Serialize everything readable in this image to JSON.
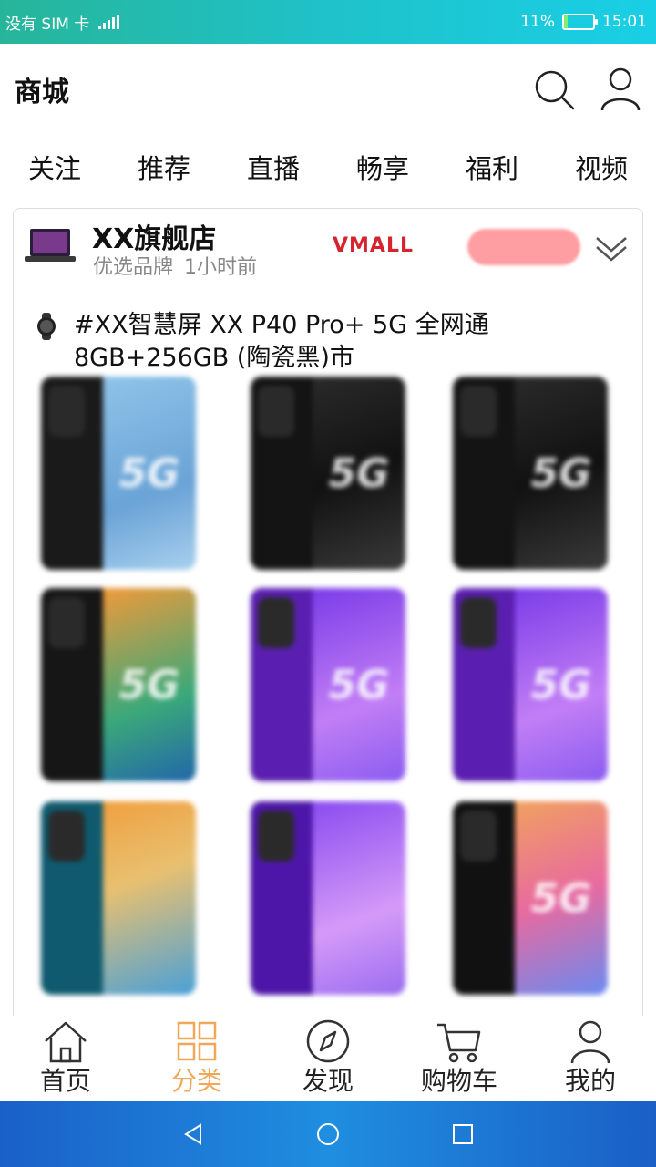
{
  "status_bar": {
    "carrier": "没有 SIM 卡",
    "battery_percent": "11%",
    "battery_level": 0.11,
    "time": "15:01"
  },
  "header": {
    "title": "商城",
    "icons": [
      "search-icon",
      "user-icon"
    ]
  },
  "tabs": [
    {
      "label": "关注"
    },
    {
      "label": "推荐"
    },
    {
      "label": "直播"
    },
    {
      "label": "畅享"
    },
    {
      "label": "福利"
    },
    {
      "label": "视频"
    }
  ],
  "post": {
    "store_name": "XX旗舰店",
    "category": "优选品牌",
    "time_ago": "1小时前",
    "brand_logo": "VMALL",
    "text_line1": "#XX智慧屏 XX P40 Pro+ 5G 全网通",
    "text_line2": "8GB+256GB (陶瓷黑)市",
    "images": [
      {
        "back": "#1a1a1a",
        "front": "linear-gradient(160deg,#8fc3e8,#6aa3d6 60%,#a8d0ee)",
        "label": "5G"
      },
      {
        "back": "#141414",
        "front": "linear-gradient(160deg,#2a2a2a,#111 50%,#3a3a3a)",
        "label": "5G"
      },
      {
        "back": "#141414",
        "front": "linear-gradient(160deg,#2a2a2a,#111 50%,#3a3a3a)",
        "label": "5G"
      },
      {
        "back": "#161616",
        "front": "linear-gradient(160deg,#f09a3a,#3aa87a 60%,#2266aa)",
        "label": "5G"
      },
      {
        "back": "#5a1fb0",
        "front": "linear-gradient(160deg,#7b3ce8,#c27ef5 60%,#8a5cf0)",
        "label": "5G"
      },
      {
        "back": "#5a1fb0",
        "front": "linear-gradient(160deg,#7b3ce8,#c27ef5 60%,#8a5cf0)",
        "label": "5G"
      },
      {
        "back": "#0f5a6e",
        "front": "linear-gradient(160deg,#f0a040,#e8c070 40%,#4aa0d8)",
        "label": ""
      },
      {
        "back": "#4d16a8",
        "front": "linear-gradient(160deg,#8a4cf0,#d59af8 60%,#9a6cf0)",
        "label": ""
      },
      {
        "back": "#111111",
        "front": "linear-gradient(160deg,#f0a060,#e86aa0 50%,#6a8af0)",
        "label": "5G"
      }
    ]
  },
  "bottom_nav": [
    {
      "label": "首页",
      "icon": "home-icon",
      "active": false
    },
    {
      "label": "分类",
      "icon": "grid-icon",
      "active": true
    },
    {
      "label": "发现",
      "icon": "compass-icon",
      "active": false
    },
    {
      "label": "购物车",
      "icon": "cart-icon",
      "active": false
    },
    {
      "label": "我的",
      "icon": "person-icon",
      "active": false
    }
  ],
  "colors": {
    "accent": "#f0a858",
    "status_bar": "#1fc2c9",
    "system_nav": "#1f7fd8",
    "follow_button": "#ff9ea2",
    "brand_red": "#d6242f"
  }
}
